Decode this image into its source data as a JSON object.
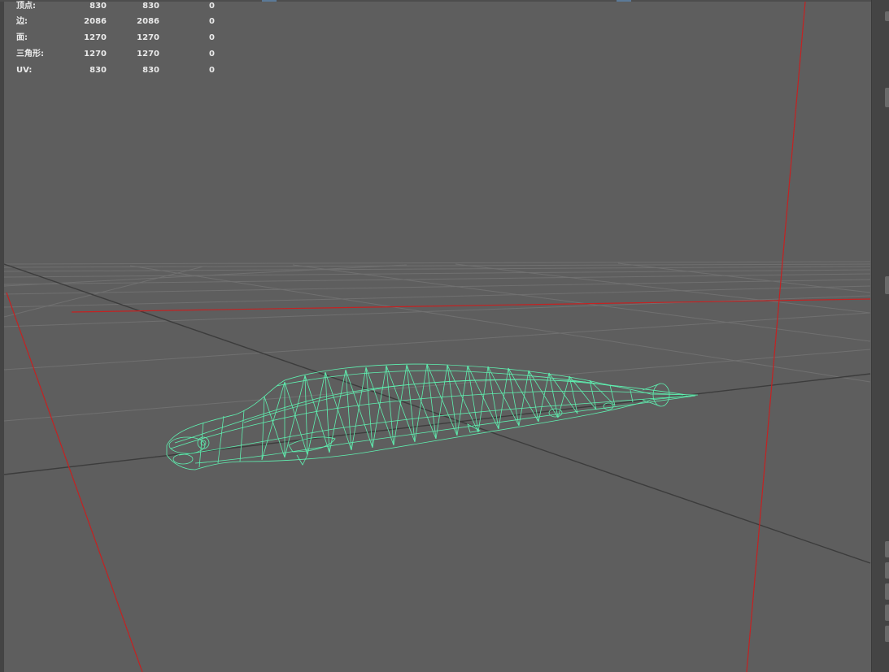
{
  "viewport": {
    "background_color": "#5e5e5e",
    "grid_color": "#6f6f6f",
    "axis_line_color": "#3f3f3f",
    "red_axis_color": "#c02020",
    "wireframe_color": "#5ff0b0"
  },
  "hud": {
    "rows": [
      {
        "label": "顶点:",
        "v1": "830",
        "v2": "830",
        "v3": "0"
      },
      {
        "label": "边:",
        "v1": "2086",
        "v2": "2086",
        "v3": "0"
      },
      {
        "label": "面:",
        "v1": "1270",
        "v2": "1270",
        "v3": "0"
      },
      {
        "label": "三角形:",
        "v1": "1270",
        "v2": "1270",
        "v3": "0"
      },
      {
        "label": "UV:",
        "v1": "830",
        "v2": "830",
        "v3": "0"
      }
    ]
  },
  "icons": {
    "panel_tabs": "panel-tab-icon"
  }
}
